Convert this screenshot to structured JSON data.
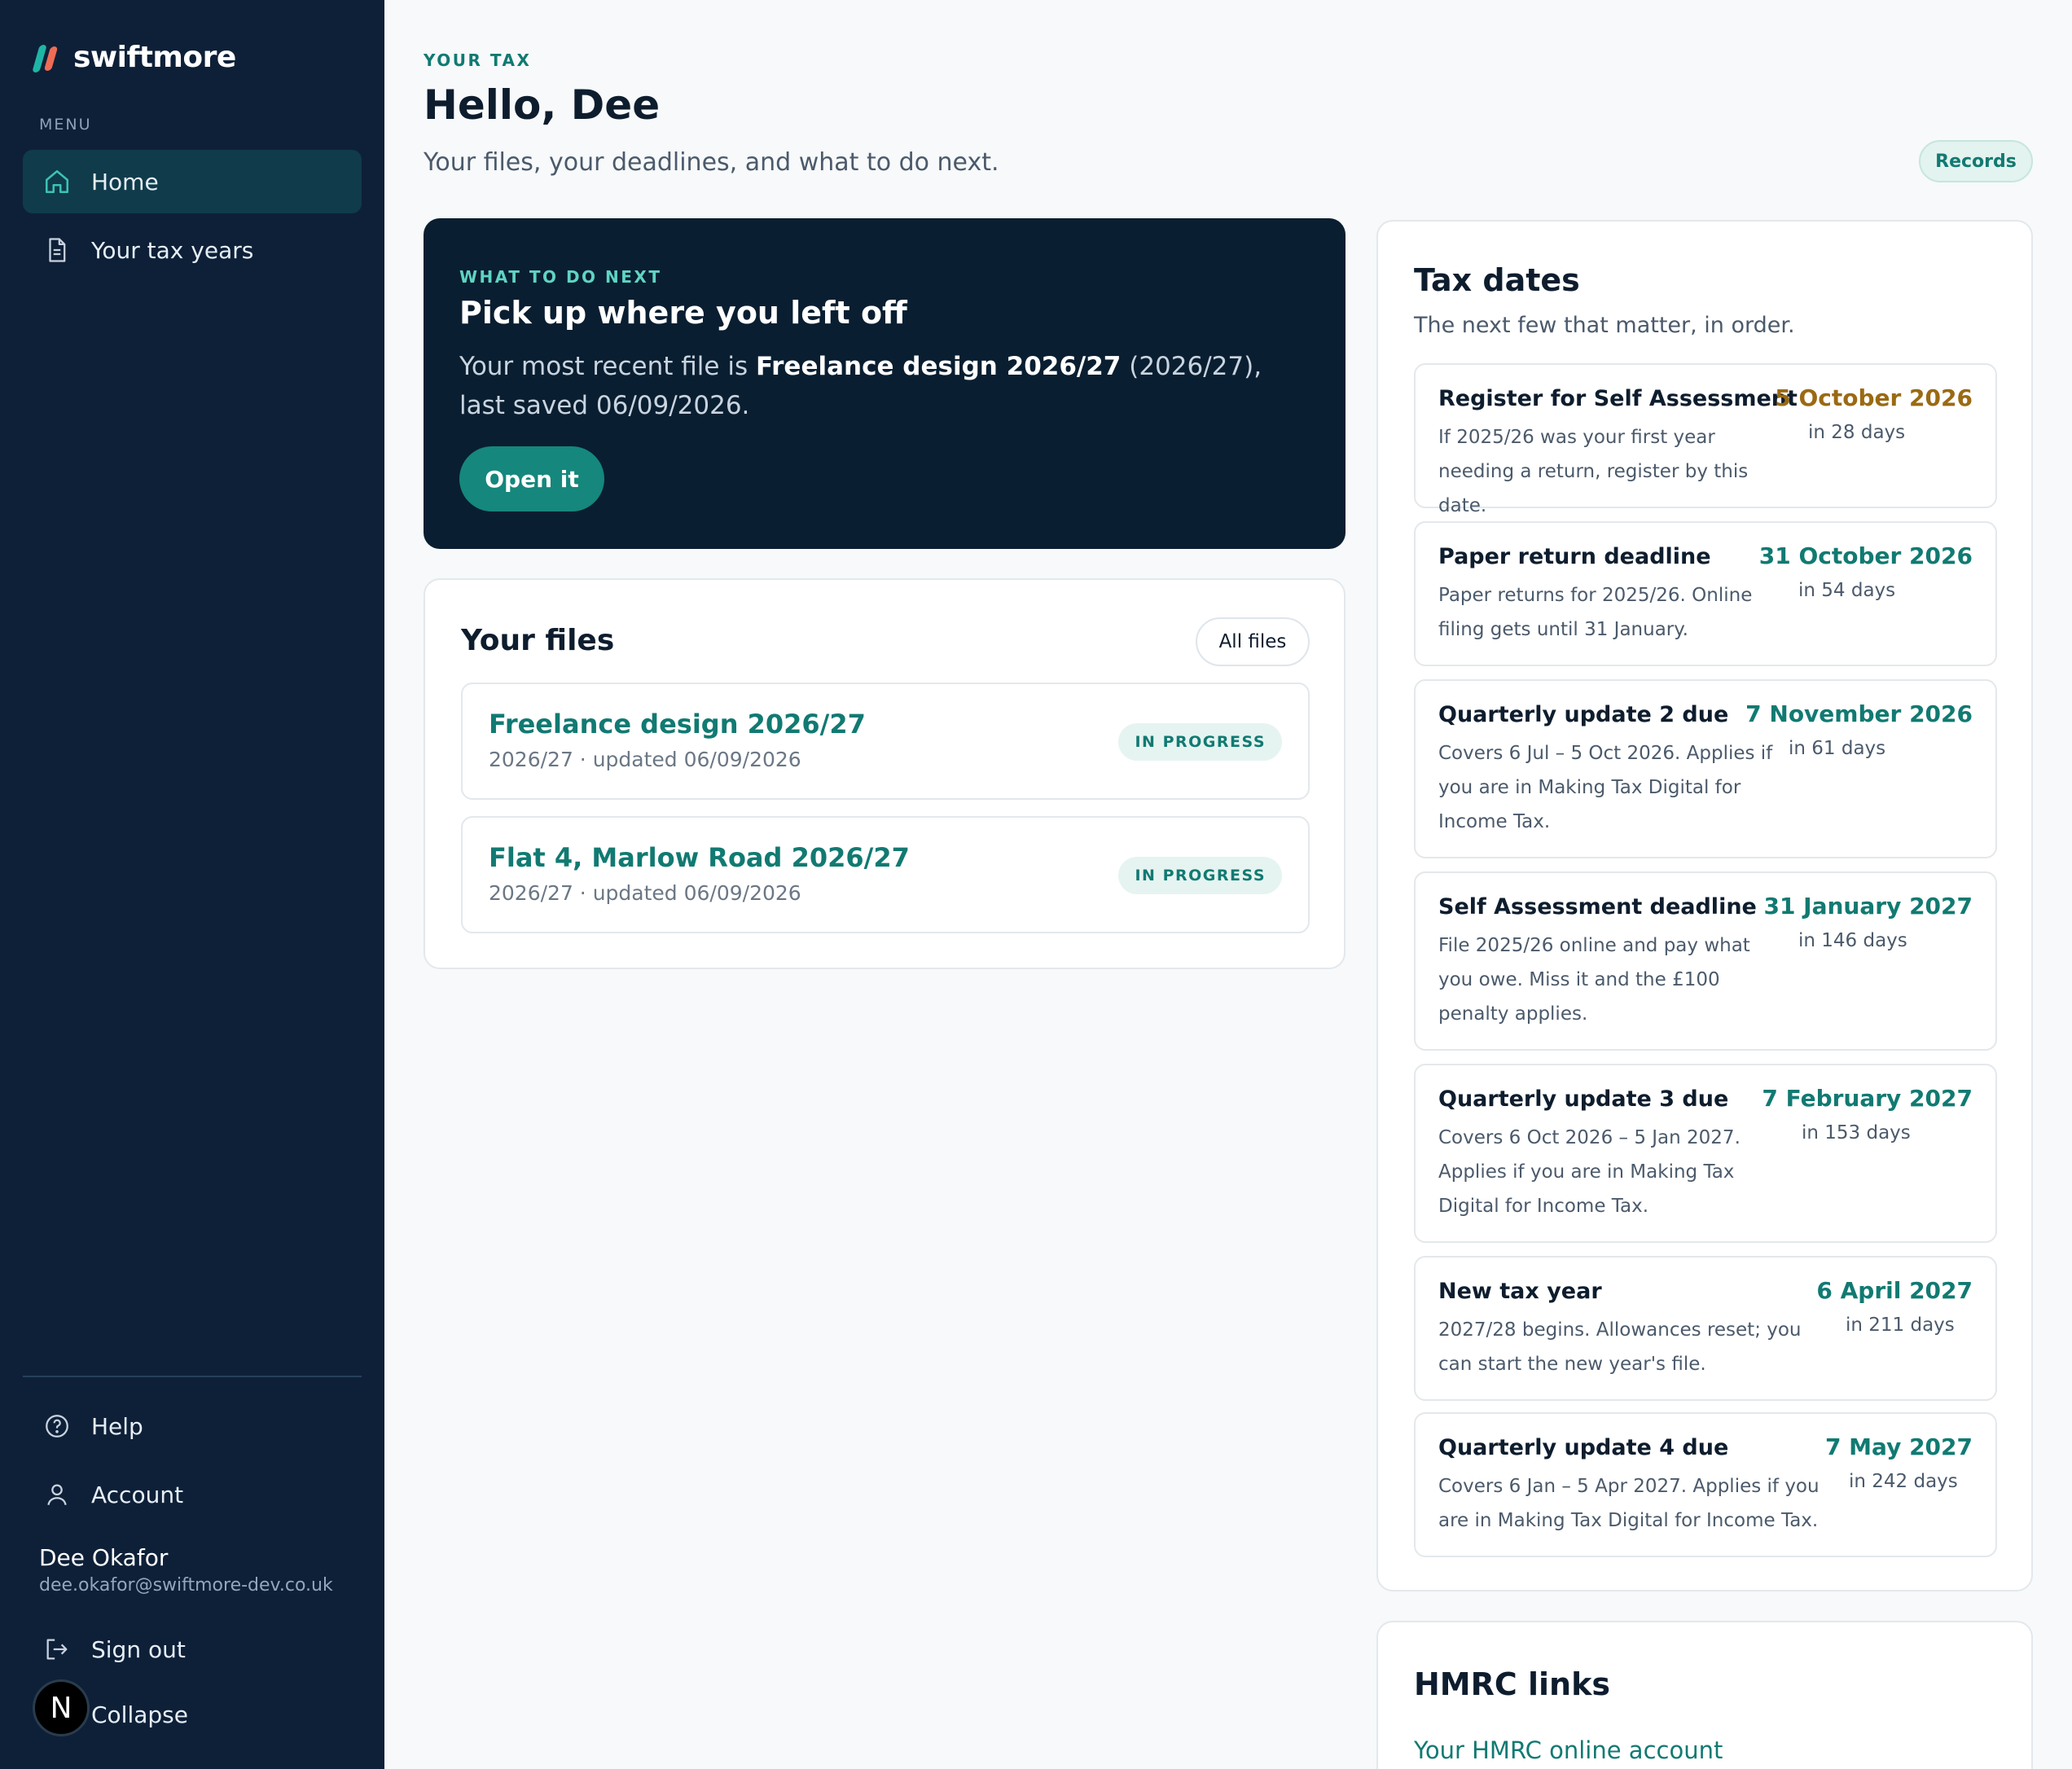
{
  "sidebar": {
    "brand": "swiftmore",
    "menu_label": "MENU",
    "items": [
      {
        "label": "Home",
        "icon": "home-icon",
        "active": true
      },
      {
        "label": "Your tax years",
        "icon": "document-icon",
        "active": false
      }
    ],
    "bottom": {
      "help": "Help",
      "account": "Account",
      "user_name": "Dee Okafor",
      "user_email": "dee.okafor@swiftmore-dev.co.uk",
      "sign_out": "Sign out",
      "collapse": "Collapse",
      "avatar_letter": "N"
    }
  },
  "header": {
    "eyebrow": "YOUR TAX",
    "title": "Hello, Dee",
    "subtitle": "Your files, your deadlines, and what to do next.",
    "records_button": "Records"
  },
  "next": {
    "eyebrow": "WHAT TO DO NEXT",
    "title": "Pick up where you left off",
    "text_before": "Your most recent file is ",
    "file_name": "Freelance design 2026/27",
    "text_after": " (2026/27), last saved 06/09/2026.",
    "button": "Open it"
  },
  "files": {
    "title": "Your files",
    "all_files_button": "All files",
    "rows": [
      {
        "name": "Freelance design 2026/27",
        "meta": "2026/27 · updated 06/09/2026",
        "status": "IN PROGRESS"
      },
      {
        "name": "Flat 4, Marlow Road 2026/27",
        "meta": "2026/27 · updated 06/09/2026",
        "status": "IN PROGRESS"
      }
    ]
  },
  "tax_dates": {
    "title": "Tax dates",
    "subtitle": "The next few that matter, in order.",
    "items": [
      {
        "title": "Register for Self Assessment",
        "desc": "If 2025/26 was your first year needing a return, register by this date.",
        "date": "5 October 2026",
        "days": "in 28 days"
      },
      {
        "title": "Paper return deadline",
        "desc": "Paper returns for 2025/26. Online filing gets until 31 January.",
        "date": "31 October 2026",
        "days": "in 54 days"
      },
      {
        "title": "Quarterly update 2 due",
        "desc": "Covers 6 Jul – 5 Oct 2026. Applies if you are in Making Tax Digital for Income Tax.",
        "date": "7 November 2026",
        "days": "in 61 days"
      },
      {
        "title": "Self Assessment deadline",
        "desc": "File 2025/26 online and pay what you owe. Miss it and the £100 penalty applies.",
        "date": "31 January 2027",
        "days": "in 146 days"
      },
      {
        "title": "Quarterly update 3 due",
        "desc": "Covers 6 Oct 2026 – 5 Jan 2027. Applies if you are in Making Tax Digital for Income Tax.",
        "date": "7 February 2027",
        "days": "in 153 days"
      },
      {
        "title": "New tax year",
        "desc": "2027/28 begins. Allowances reset; you can start the new year's file.",
        "date": "6 April 2027",
        "days": "in 211 days"
      },
      {
        "title": "Quarterly update 4 due",
        "desc": "Covers 6 Jan – 5 Apr 2027. Applies if you are in Making Tax Digital for Income Tax.",
        "date": "7 May 2027",
        "days": "in 242 days"
      }
    ]
  },
  "hmrc": {
    "title": "HMRC links",
    "link": "Your HMRC online account"
  },
  "colors": {
    "sidebar_bg": "#0e2038",
    "accent": "#117a72",
    "warn_date": "#9a6a13",
    "next_card_bg": "#0a1e31"
  }
}
